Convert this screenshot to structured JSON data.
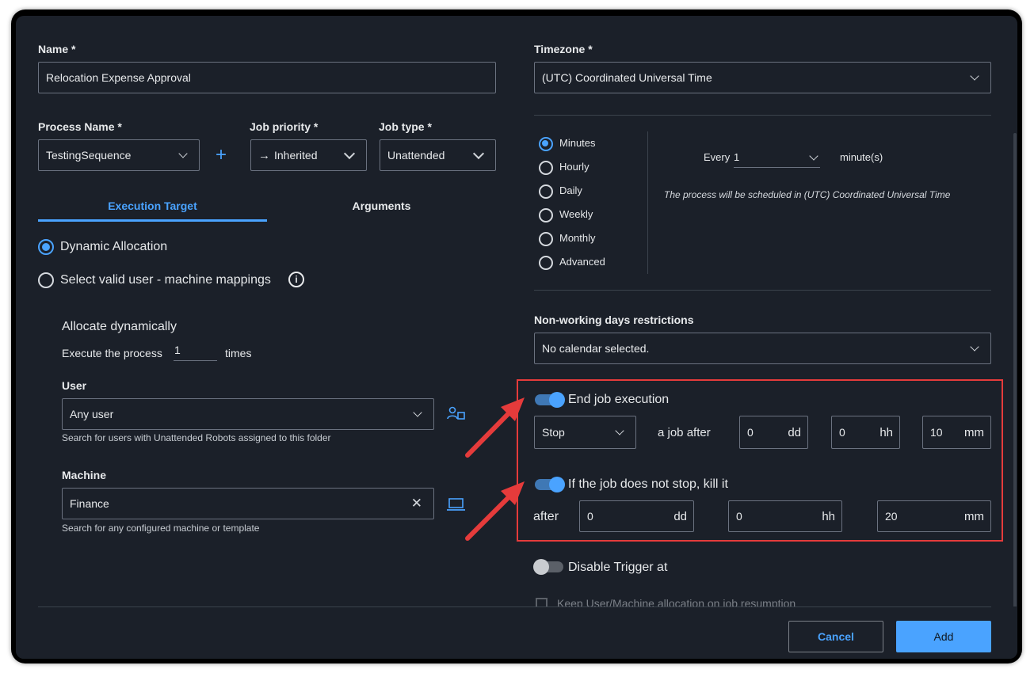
{
  "form": {
    "name_label": "Name *",
    "name_value": "Relocation Expense Approval",
    "process_label": "Process Name *",
    "process_value": "TestingSequence",
    "priority_label": "Job priority *",
    "priority_value": "Inherited",
    "jobtype_label": "Job type *",
    "jobtype_value": "Unattended"
  },
  "tabs": [
    {
      "label": "Execution Target",
      "active": true
    },
    {
      "label": "Arguments",
      "active": false
    }
  ],
  "target": {
    "dynamic_label": "Dynamic Allocation",
    "mapping_label": "Select valid user - machine mappings",
    "allocate_title": "Allocate dynamically",
    "execute_label": "Execute the process",
    "execute_value": "1",
    "times_label": "times",
    "user_label": "User",
    "user_value": "Any user",
    "user_hint": "Search for users with Unattended Robots assigned to this folder",
    "machine_label": "Machine",
    "machine_value": "Finance",
    "machine_hint": "Search for any configured machine or template"
  },
  "schedule": {
    "timezone_label": "Timezone *",
    "timezone_value": "(UTC) Coordinated Universal Time",
    "options": [
      "Minutes",
      "Hourly",
      "Daily",
      "Weekly",
      "Monthly",
      "Advanced"
    ],
    "selected": "Minutes",
    "every_label": "Every",
    "every_value": "1",
    "unit_label": "minute(s)",
    "note": "The process will be scheduled in (UTC) Coordinated Universal Time"
  },
  "calendar": {
    "label": "Non-working days restrictions",
    "value": "No calendar selected."
  },
  "end_job": {
    "label": "End job execution",
    "enabled": true,
    "action_value": "Stop",
    "after_label": "a job after",
    "dd": "0",
    "hh": "0",
    "mm": "10"
  },
  "kill_job": {
    "label": "If the job does not stop, kill it",
    "enabled": true,
    "after_label": "after",
    "dd": "0",
    "hh": "0",
    "mm": "20"
  },
  "units": {
    "dd": "dd",
    "hh": "hh",
    "mm": "mm"
  },
  "disable_trigger": {
    "label": "Disable Trigger at",
    "enabled": false
  },
  "keep_allocation": {
    "label": "Keep User/Machine allocation on job resumption"
  },
  "buttons": {
    "cancel": "Cancel",
    "add": "Add"
  },
  "colors": {
    "accent": "#4aa3ff",
    "background": "#1b2029",
    "highlight_box": "#e53b3b",
    "arrow": "#e53b3b"
  }
}
